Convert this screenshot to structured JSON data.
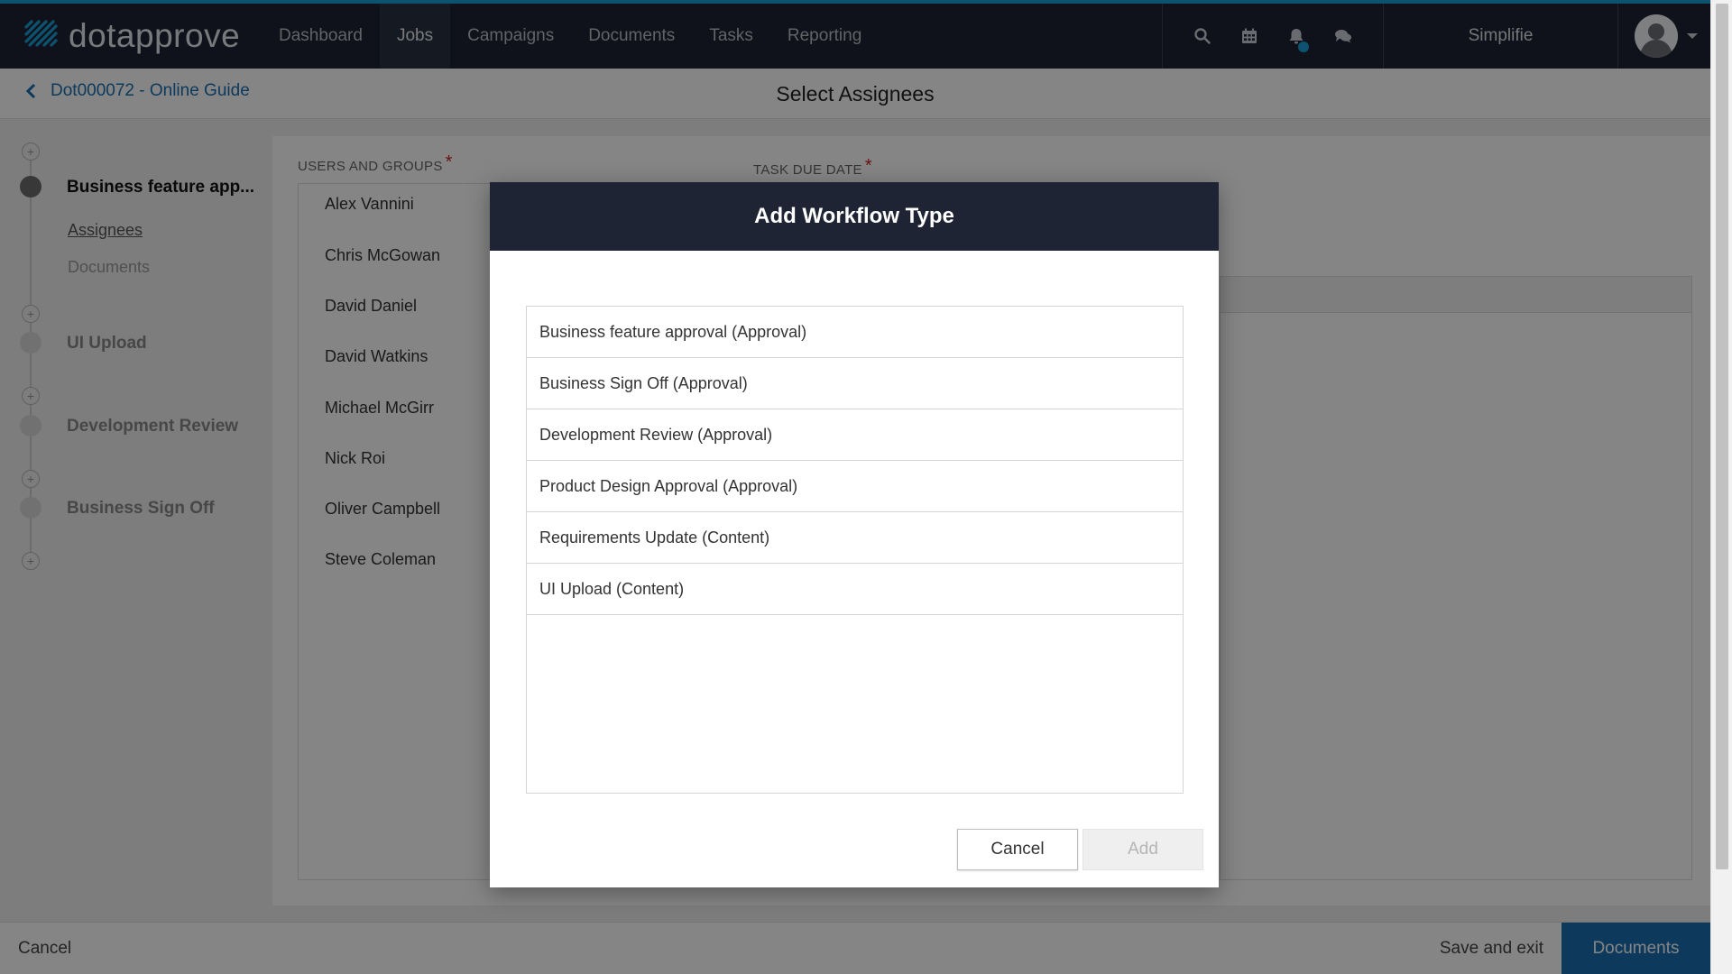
{
  "brand": {
    "name": "dotapprove",
    "accent": "#1aa0d8",
    "nav_bg": "#1e2433"
  },
  "nav": {
    "items": [
      {
        "label": "Dashboard"
      },
      {
        "label": "Jobs",
        "active": true
      },
      {
        "label": "Campaigns"
      },
      {
        "label": "Documents"
      },
      {
        "label": "Tasks"
      },
      {
        "label": "Reporting"
      }
    ],
    "icons": [
      "search-icon",
      "calendar-icon",
      "bell-icon",
      "chat-icon"
    ],
    "account": "Simplifie"
  },
  "subheader": {
    "back_label": "Dot000072 - Online Guide",
    "title": "Select Assignees"
  },
  "steps": [
    {
      "label": "Business feature app...",
      "current": true,
      "sub": [
        "Assignees",
        "Documents"
      ]
    },
    {
      "label": "UI Upload"
    },
    {
      "label": "Development Review"
    },
    {
      "label": "Business Sign Off"
    }
  ],
  "form": {
    "users_label": "USERS AND GROUPS",
    "due_label": "TASK DUE DATE",
    "required_mark": "*",
    "users": [
      "Alex Vannini",
      "Chris McGowan",
      "David Daniel",
      "David Watkins",
      "Michael McGirr",
      "Nick Roi",
      "Oliver Campbell",
      "Steve Coleman"
    ]
  },
  "footer": {
    "cancel": "Cancel",
    "save": "Save and exit",
    "next": "Documents"
  },
  "modal": {
    "title": "Add Workflow Type",
    "types": [
      "Business feature approval (Approval)",
      "Business Sign Off (Approval)",
      "Development Review (Approval)",
      "Product Design Approval (Approval)",
      "Requirements Update (Content)",
      "UI Upload (Content)"
    ],
    "cancel": "Cancel",
    "add": "Add"
  }
}
